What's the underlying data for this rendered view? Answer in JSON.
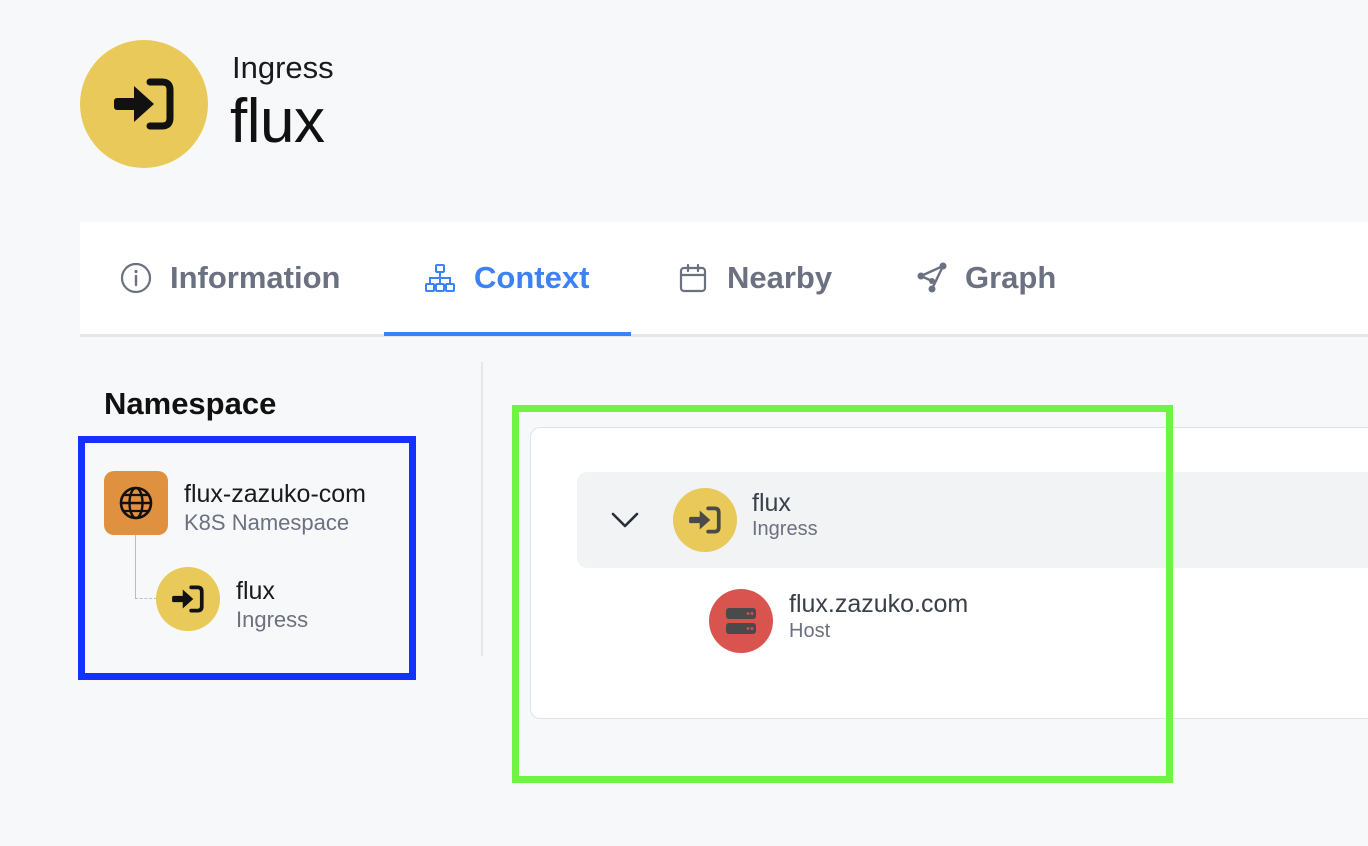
{
  "header": {
    "resource_type": "Ingress",
    "resource_name": "flux",
    "icon": "ingress-arrow-icon",
    "icon_color": "#e8c95a"
  },
  "tabs": [
    {
      "label": "Information",
      "icon": "info-circle-icon",
      "active": false
    },
    {
      "label": "Context",
      "icon": "hierarchy-icon",
      "active": true
    },
    {
      "label": "Nearby",
      "icon": "calendar-icon",
      "active": false
    },
    {
      "label": "Graph",
      "icon": "graph-icon",
      "active": false
    }
  ],
  "colors": {
    "accent": "#3b82f6",
    "ingress": "#e8c95a",
    "namespace": "#e0913f",
    "host": "#d9534f",
    "highlight_blue": "#1432ff",
    "highlight_green": "#6ef542"
  },
  "sidebar": {
    "heading": "Namespace",
    "namespace": {
      "name": "flux-zazuko-com",
      "kind": "K8S Namespace",
      "icon": "globe-icon"
    },
    "child": {
      "name": "flux",
      "kind": "Ingress",
      "icon": "ingress-arrow-icon"
    }
  },
  "context_tree": {
    "root": {
      "name": "flux",
      "kind": "Ingress",
      "expanded": true,
      "icon": "ingress-arrow-icon"
    },
    "children": [
      {
        "name": "flux.zazuko.com",
        "kind": "Host",
        "icon": "server-icon"
      }
    ]
  }
}
